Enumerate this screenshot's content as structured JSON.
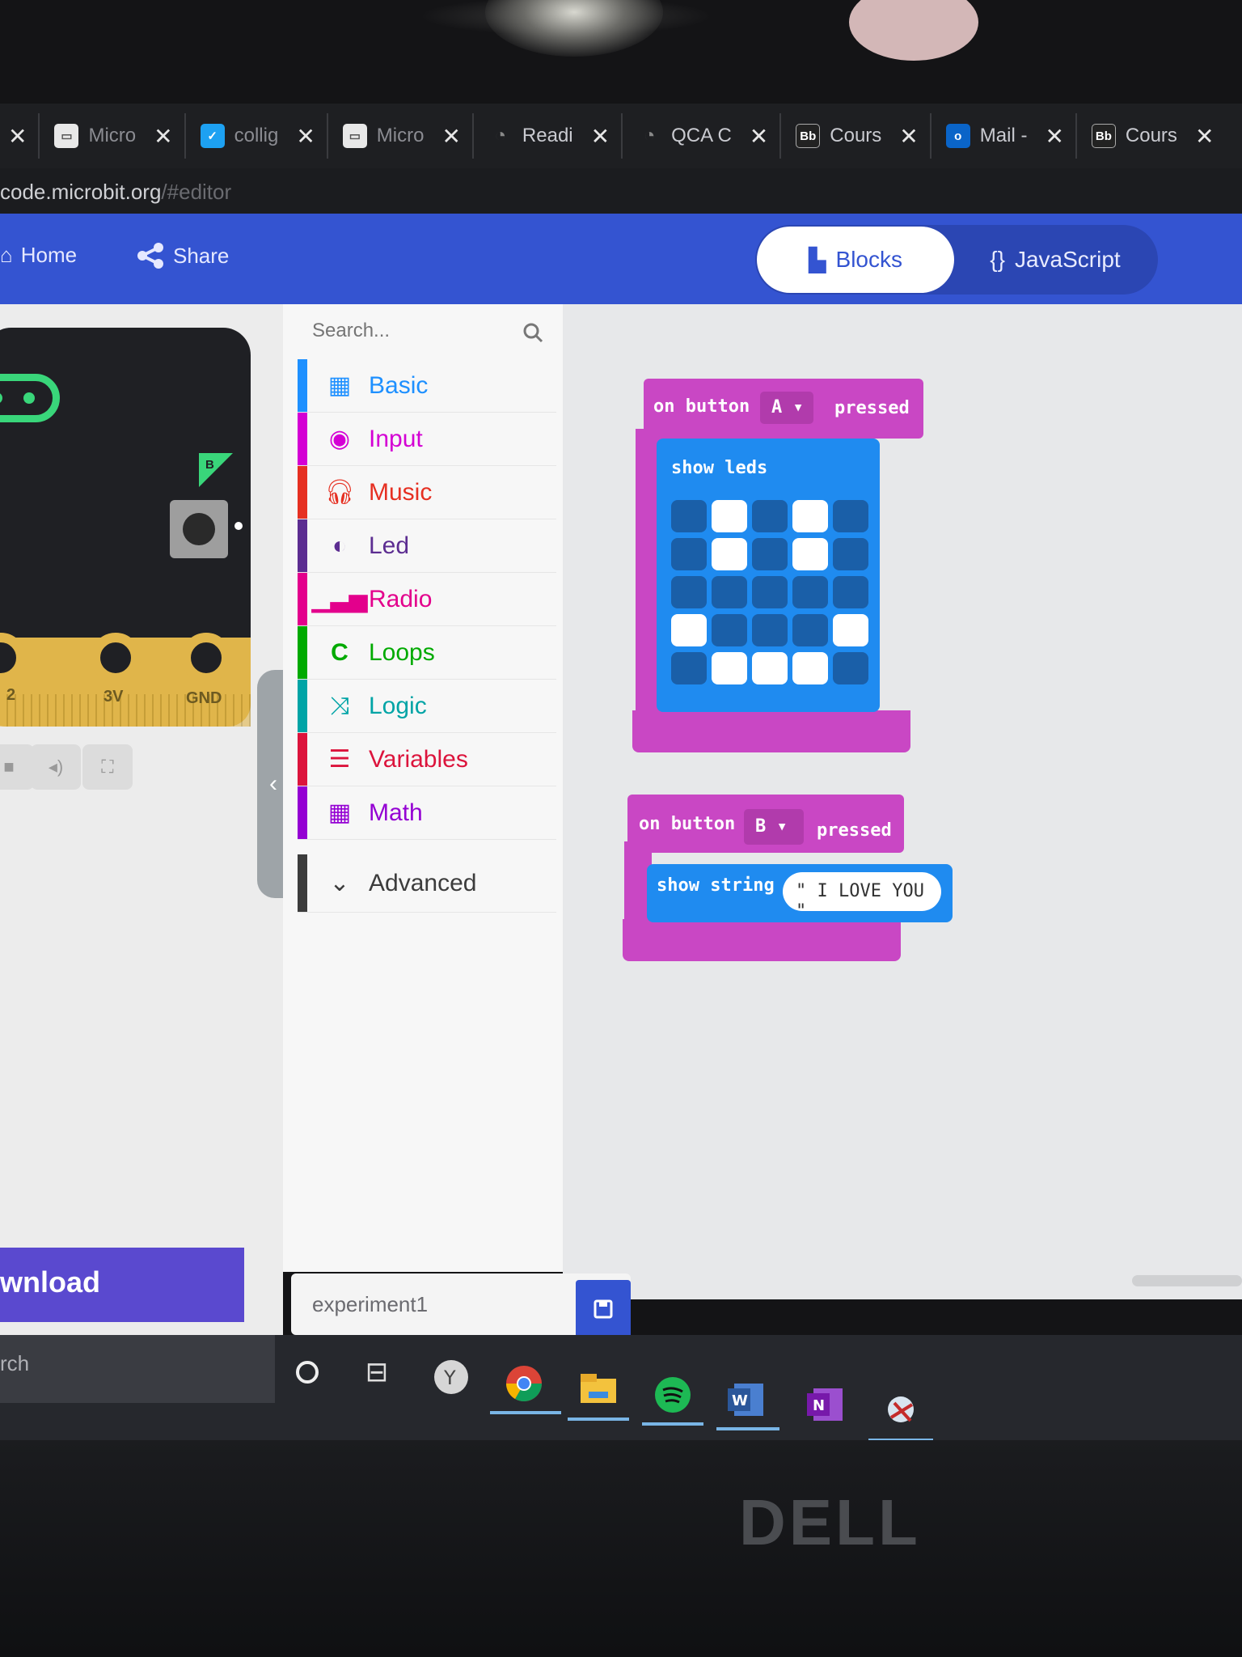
{
  "browser": {
    "tabs": [
      {
        "label": "Micro",
        "icon": "microbit-favicon",
        "icon_color": "#e8e8e8"
      },
      {
        "label": "collig",
        "icon": "twitter-favicon",
        "icon_color": "#1da1f2"
      },
      {
        "label": "Micro",
        "icon": "microbit-favicon",
        "icon_color": "#e8e8e8"
      },
      {
        "label": "Readi",
        "icon": "loading-globe",
        "icon_color": "#777"
      },
      {
        "label": "QCA C",
        "icon": "loading-globe",
        "icon_color": "#777"
      },
      {
        "label": "Cours",
        "icon": "blackboard-favicon",
        "icon_color": "#222",
        "icon_text": "Bb"
      },
      {
        "label": "Mail -",
        "icon": "outlook-favicon",
        "icon_color": "#0a64c8",
        "icon_text": "o"
      },
      {
        "label": "Cours",
        "icon": "blackboard-favicon",
        "icon_color": "#222",
        "icon_text": "Bb"
      }
    ],
    "url_host": "code.microbit.org",
    "url_path": "/#editor"
  },
  "header": {
    "home_label": "Home",
    "share_label": "Share",
    "blocks_label": "Blocks",
    "javascript_label": "JavaScript",
    "javascript_icon_text": "{}",
    "brand_color": "#3454d1"
  },
  "simulator": {
    "button_b_label": "B",
    "pin_labels": [
      "2",
      "3V",
      "GND"
    ],
    "controls": [
      "stop-icon",
      "mute-icon",
      "fullscreen-icon"
    ]
  },
  "toolbox": {
    "search_placeholder": "Search...",
    "categories": [
      {
        "label": "Basic",
        "color": "#1e90ff",
        "icon": "grid-icon"
      },
      {
        "label": "Input",
        "color": "#d400d4",
        "icon": "target-icon"
      },
      {
        "label": "Music",
        "color": "#e63022",
        "icon": "headphones-icon"
      },
      {
        "label": "Led",
        "color": "#5c2d91",
        "icon": "toggle-icon"
      },
      {
        "label": "Radio",
        "color": "#e3008c",
        "icon": "signal-bars-icon"
      },
      {
        "label": "Loops",
        "color": "#00aa00",
        "icon": "loop-icon"
      },
      {
        "label": "Logic",
        "color": "#00a4a6",
        "icon": "shuffle-icon"
      },
      {
        "label": "Variables",
        "color": "#dc143c",
        "icon": "lines-icon"
      },
      {
        "label": "Math",
        "color": "#9400d3",
        "icon": "calculator-icon"
      },
      {
        "label": "Advanced",
        "color": "#3c3c3c",
        "icon": "chevron-down-icon"
      }
    ]
  },
  "workspace": {
    "event_a": {
      "prefix": "on button",
      "button": "A ▾",
      "suffix": "pressed"
    },
    "show_leds_label": "show leds",
    "leds": [
      [
        0,
        1,
        0,
        1,
        0
      ],
      [
        0,
        1,
        0,
        1,
        0
      ],
      [
        0,
        0,
        0,
        0,
        0
      ],
      [
        1,
        0,
        0,
        0,
        1
      ],
      [
        0,
        1,
        1,
        1,
        0
      ]
    ],
    "event_b": {
      "prefix": "on button",
      "button": "B ▾",
      "suffix": "pressed"
    },
    "show_string_label": "show string",
    "string_value": "\" I LOVE YOU \""
  },
  "footer": {
    "download_label": "wnload",
    "project_name": "experiment1",
    "save_icon": "floppy-icon"
  },
  "taskbar": {
    "search_text": "rch",
    "apps": [
      "cortana-icon",
      "task-view-icon",
      "yahoo-browser-icon",
      "chrome-icon",
      "file-explorer-icon",
      "spotify-icon",
      "word-icon",
      "onenote-icon",
      "snipping-tool-icon"
    ]
  },
  "laptop": {
    "brand": "DELL"
  }
}
